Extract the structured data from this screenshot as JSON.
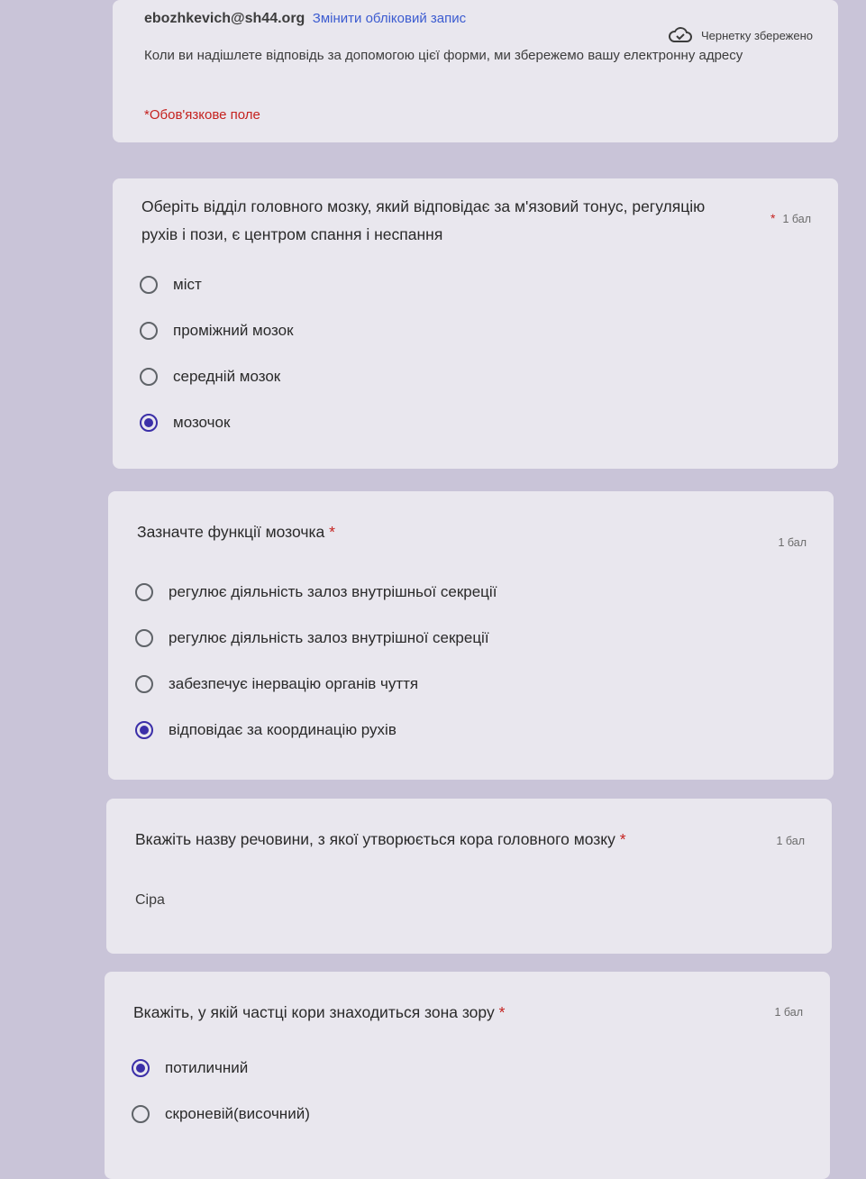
{
  "header": {
    "email": "ebozhkevich@sh44.org",
    "switch_account": "Змінити обліковий запис",
    "draft_status": "Чернетку збережено",
    "info": "Коли ви надішлете відповідь за допомогою цієї форми, ми збережемо вашу електронну адресу",
    "required_note": "*Обов'язкове поле"
  },
  "questions": [
    {
      "title": "Оберіть відділ головного мозку, який відповідає за м'язовий тонус, регуляцію рухів і пози, є центром спання і неспання",
      "required": "*",
      "points": "1 бал",
      "options": [
        "міст",
        "проміжний мозок",
        "середній мозок",
        "мозочок"
      ],
      "selected": "мозочок"
    },
    {
      "title": "Зазначте функції мозочка",
      "required": "*",
      "points": "1 бал",
      "options": [
        "регулює діяльність залоз внутрішньої секреції",
        "регулює діяльність залоз внутрішної секреції",
        "забезпечує інервацію  органів чуття",
        "відповідає за координацію рухів"
      ],
      "selected": "відповідає за координацію рухів"
    },
    {
      "title": "Вкажіть назву речовини, з якої утворюється кора головного мозку",
      "required": "*",
      "points": "1 бал",
      "answer": "Сіра"
    },
    {
      "title": "Вкажіть, у якій частці кори знаходиться зона зору",
      "required": "*",
      "points": "1 бал",
      "options": [
        "потиличний",
        "скроневій(височний)"
      ],
      "selected": "потиличний"
    }
  ],
  "colors": {
    "accent": "#3b2fa8",
    "required": "#c5221f",
    "link": "#3b5bd0"
  },
  "icons": {
    "draft": "cloud-check-icon",
    "option": "radio-icon"
  }
}
